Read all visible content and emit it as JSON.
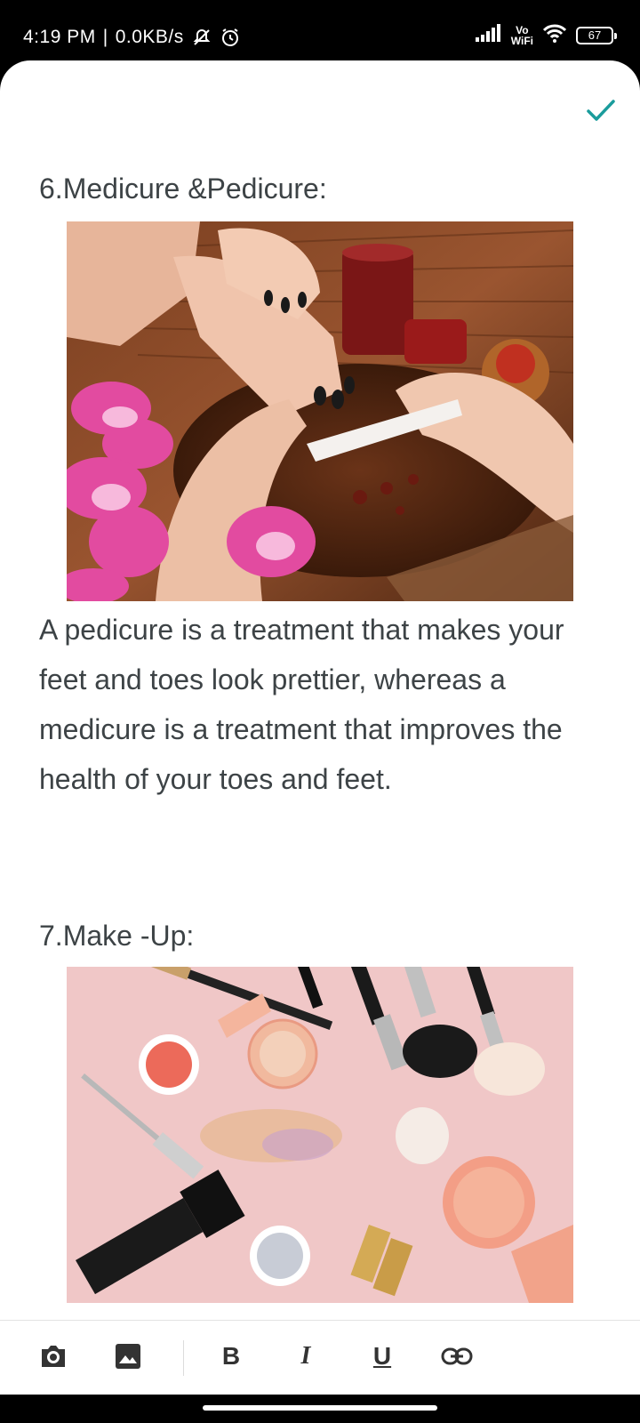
{
  "status_bar": {
    "time": "4:19 PM",
    "separator": "|",
    "net_speed": "0.0KB/s",
    "vowifi_top": "Vo",
    "vowifi_bottom": "WiFi",
    "battery": "67",
    "icons": [
      "mute-icon",
      "alarm-icon",
      "signal-icon",
      "wifi-icon",
      "battery-icon"
    ]
  },
  "editor": {
    "done_icon": "check-icon",
    "accent_color": "#1a9c9c",
    "section6_heading": "6.Medicure &Pedicure:",
    "section6_image": "manicure-photo",
    "section6_body": " A pedicure is a treatment that makes your feet and toes look prettier, whereas a medicure is a treatment that improves the health of your toes and feet.",
    "section7_heading": "7.Make -Up:",
    "section7_image": "makeup-photo"
  },
  "toolbar": {
    "camera_icon": "camera-icon",
    "image_icon": "image-icon",
    "bold_label": "B",
    "italic_label": "I",
    "underline_label": "U",
    "link_icon": "link-icon"
  }
}
